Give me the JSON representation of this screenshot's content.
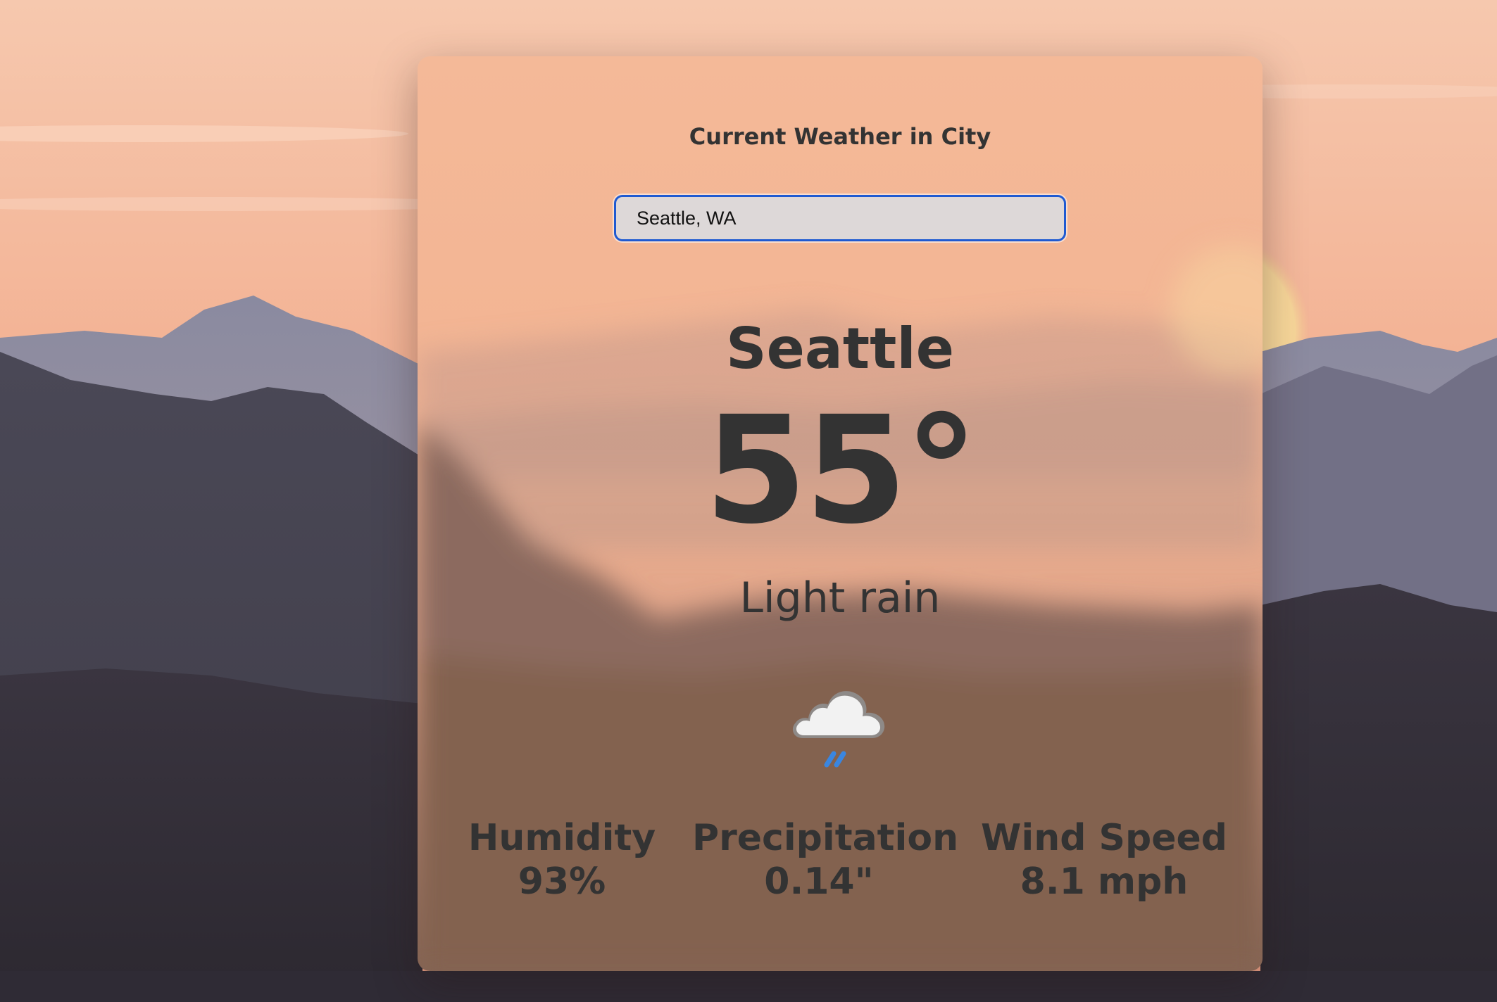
{
  "header": {
    "title": "Current Weather in City"
  },
  "search": {
    "value": "Seattle, WA"
  },
  "weather": {
    "city": "Seattle",
    "temperature": "55°",
    "condition": "Light rain",
    "icon": "cloud-rain-icon"
  },
  "stats": {
    "humidity": {
      "label": "Humidity",
      "value": "93%"
    },
    "precipitation": {
      "label": "Precipitation",
      "value": "0.14\""
    },
    "wind_speed": {
      "label": "Wind Speed",
      "value": "8.1 mph"
    }
  },
  "colors": {
    "sky_top": "#f6c7ad",
    "sky_horizon": "#f0a788",
    "mountain_far": "#7d7e92",
    "mountain_near": "#3d3b47",
    "text": "#333333",
    "input_border": "#1f5ad1",
    "rain_drops": "#3a86e0"
  }
}
